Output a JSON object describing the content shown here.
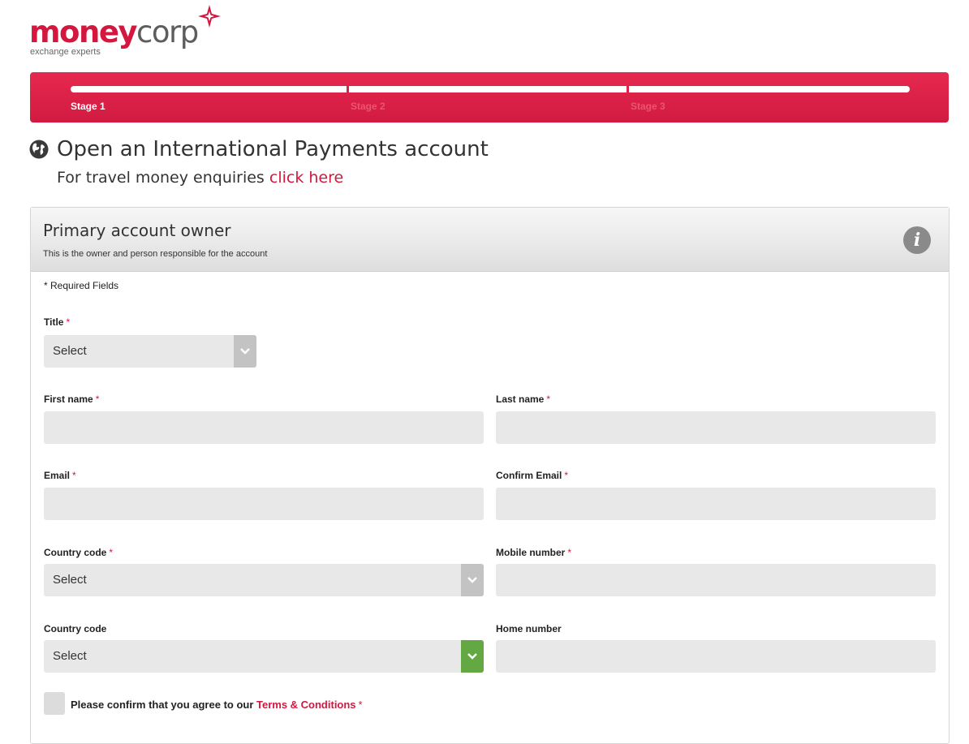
{
  "brand": {
    "name_part1": "money",
    "name_part2": "corp",
    "tagline": "exchange experts"
  },
  "progress": {
    "stages": [
      "Stage 1",
      "Stage 2",
      "Stage 3"
    ],
    "active_stage_index": 0
  },
  "heading": {
    "title": "Open an International Payments account",
    "sub_text": "For travel money enquiries ",
    "sub_link": "click here"
  },
  "panel": {
    "title": "Primary account owner",
    "subtitle": "This is the owner and person responsible for the account",
    "info_icon_glyph": "i",
    "required_note": "* Required Fields"
  },
  "form": {
    "required_marker": "*",
    "title_label": "Title",
    "title_value": "Select",
    "first_name_label": "First name",
    "last_name_label": "Last name",
    "email_label": "Email",
    "confirm_email_label": "Confirm Email",
    "mobile_country_code_label": "Country code",
    "mobile_country_code_value": "Select",
    "mobile_number_label": "Mobile number",
    "home_country_code_label": "Country code",
    "home_country_code_value": "Select",
    "home_number_label": "Home number",
    "terms_text": "Please confirm that you agree to our ",
    "terms_link": "Terms & Conditions"
  },
  "colors": {
    "brand_red": "#d4173f",
    "progress_red": "#e02149",
    "select_green": "#64a844",
    "field_grey": "#e8e8e8"
  },
  "icons": {
    "heading": "globe-icon",
    "panel": "info-icon",
    "select": "chevron-down-icon",
    "logo": "star-icon"
  }
}
